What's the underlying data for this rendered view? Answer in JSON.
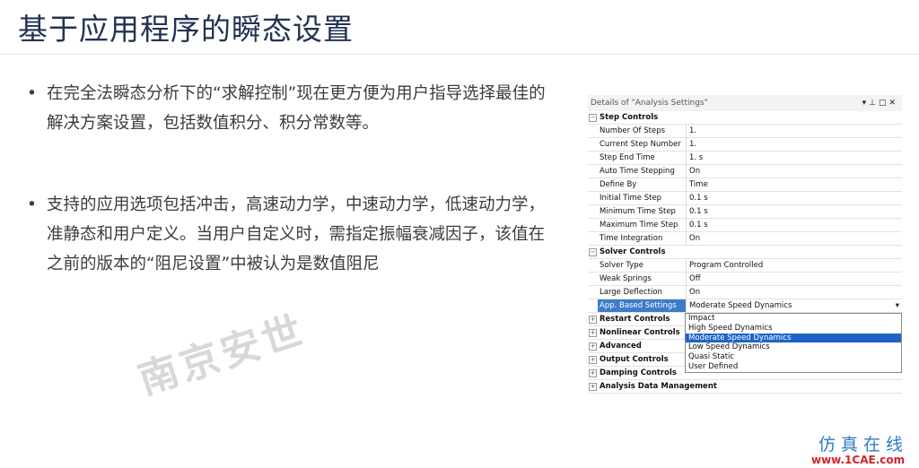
{
  "title": "基于应用程序的瞬态设置",
  "bullets": [
    "在完全法瞬态分析下的“求解控制”现在更方便为用户指导选择最佳的解决方案设置，包括数值积分、积分常数等。",
    "支持的应用选项包括冲击，高速动力学，中速动力学，低速动力学，准静态和用户定义。当用户自定义时，需指定振幅衰减因子，该值在之前的版本的“阻尼设置”中被认为是数值阻尼"
  ],
  "watermark": "南京安世",
  "panel": {
    "title": "Details of \"Analysis Settings\"",
    "step_controls": {
      "label": "Step Controls",
      "rows": [
        [
          "Number Of Steps",
          "1."
        ],
        [
          "Current Step Number",
          "1."
        ],
        [
          "Step End Time",
          "1. s"
        ],
        [
          "Auto Time Stepping",
          "On"
        ],
        [
          "Define By",
          "Time"
        ],
        [
          "Initial Time Step",
          "0.1 s"
        ],
        [
          "Minimum Time Step",
          "0.1 s"
        ],
        [
          "Maximum Time Step",
          "0.1 s"
        ],
        [
          "Time Integration",
          "On"
        ]
      ]
    },
    "solver_controls": {
      "label": "Solver Controls",
      "rows": [
        [
          "Solver Type",
          "Program Controlled"
        ],
        [
          "Weak Springs",
          "Off"
        ],
        [
          "Large Deflection",
          "On"
        ],
        [
          "App. Based Settings",
          "Moderate Speed Dynamics"
        ]
      ]
    },
    "collapsed": [
      "Restart Controls",
      "Nonlinear Controls",
      "Advanced",
      "Output Controls",
      "Damping Controls",
      "Analysis Data Management"
    ],
    "dropdown_options": [
      "Impact",
      "High Speed Dynamics",
      "Moderate Speed Dynamics",
      "Low Speed Dynamics",
      "Quasi Static",
      "User Defined"
    ],
    "selected_option": "Moderate Speed Dynamics"
  },
  "logo": {
    "cn": "仿真在线",
    "url": "www.1CAE.com"
  }
}
